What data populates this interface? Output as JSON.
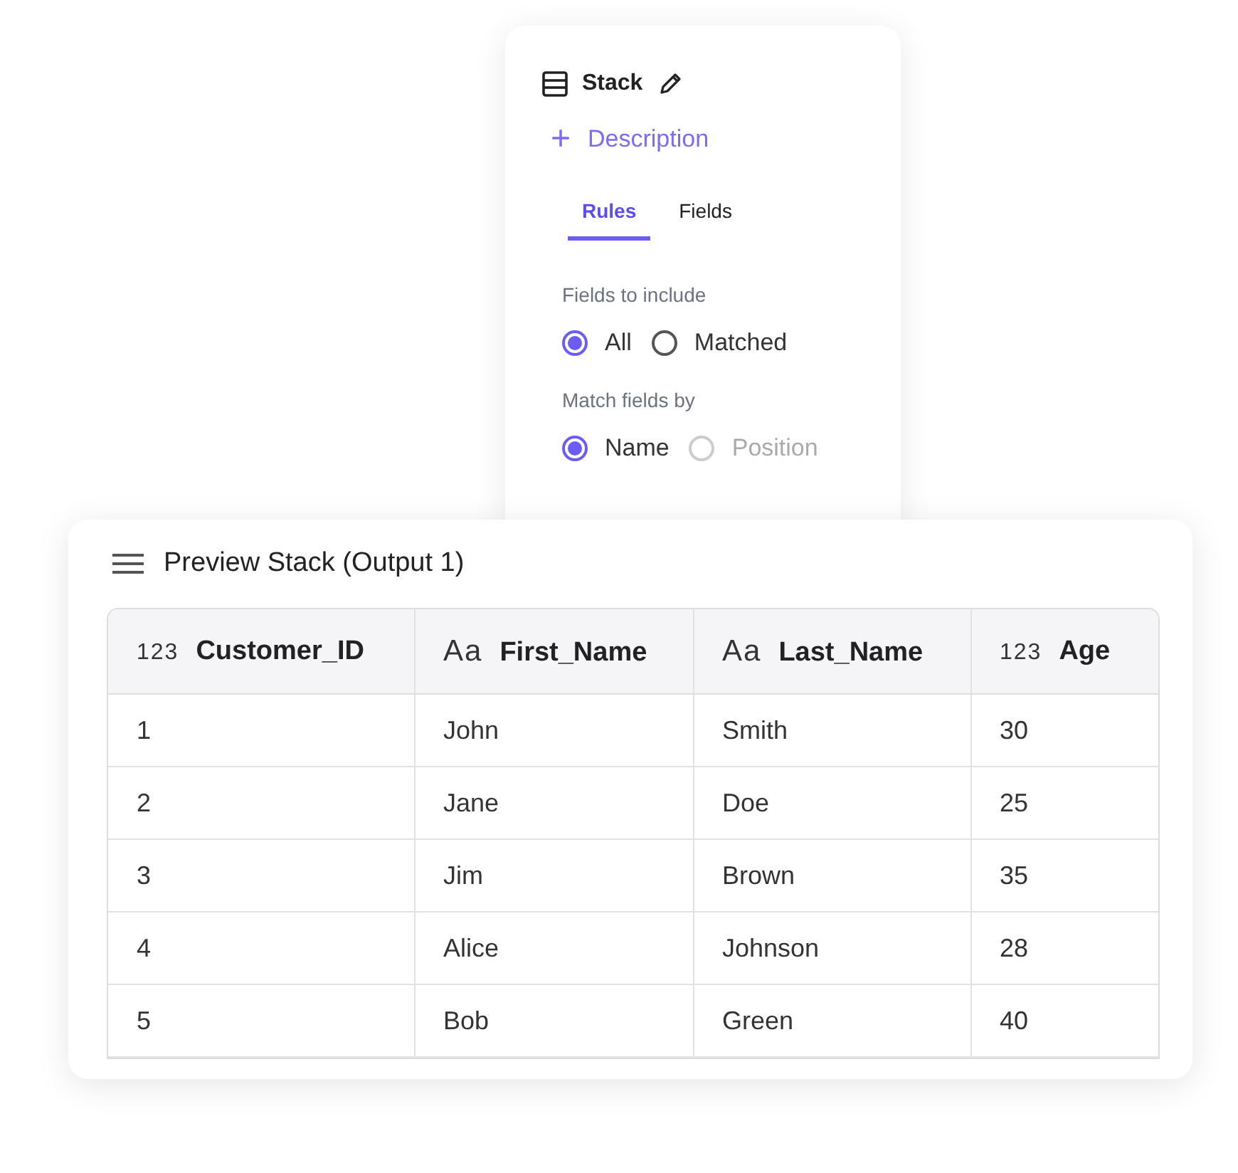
{
  "node": {
    "title": "Stack",
    "description_action": {
      "icon": "+",
      "label": "Description"
    },
    "tabs": [
      {
        "label": "Rules",
        "selected": true
      },
      {
        "label": "Fields",
        "selected": false
      }
    ],
    "groups": [
      {
        "label": "Fields to include",
        "options": [
          {
            "label": "All",
            "selected": true,
            "disabled": false
          },
          {
            "label": "Matched",
            "selected": false,
            "disabled": false
          }
        ]
      },
      {
        "label": "Match fields by",
        "options": [
          {
            "label": "Name",
            "selected": true,
            "disabled": false
          },
          {
            "label": "Position",
            "selected": false,
            "disabled": true
          }
        ]
      }
    ]
  },
  "preview": {
    "title": "Preview Stack (Output 1)",
    "table": {
      "columns": [
        {
          "type_label": "123",
          "kind": "number",
          "label": "Customer_ID"
        },
        {
          "type_label": "Aa",
          "kind": "text",
          "label": "First_Name"
        },
        {
          "type_label": "Aa",
          "kind": "text",
          "label": "Last_Name"
        },
        {
          "type_label": "123",
          "kind": "number",
          "label": "Age"
        }
      ],
      "rows": [
        [
          "1",
          "John",
          "Smith",
          "30"
        ],
        [
          "2",
          "Jane",
          "Doe",
          "25"
        ],
        [
          "3",
          "Jim",
          "Brown",
          "35"
        ],
        [
          "4",
          "Alice",
          "Johnson",
          "28"
        ],
        [
          "5",
          "Bob",
          "Green",
          "40"
        ]
      ]
    }
  }
}
